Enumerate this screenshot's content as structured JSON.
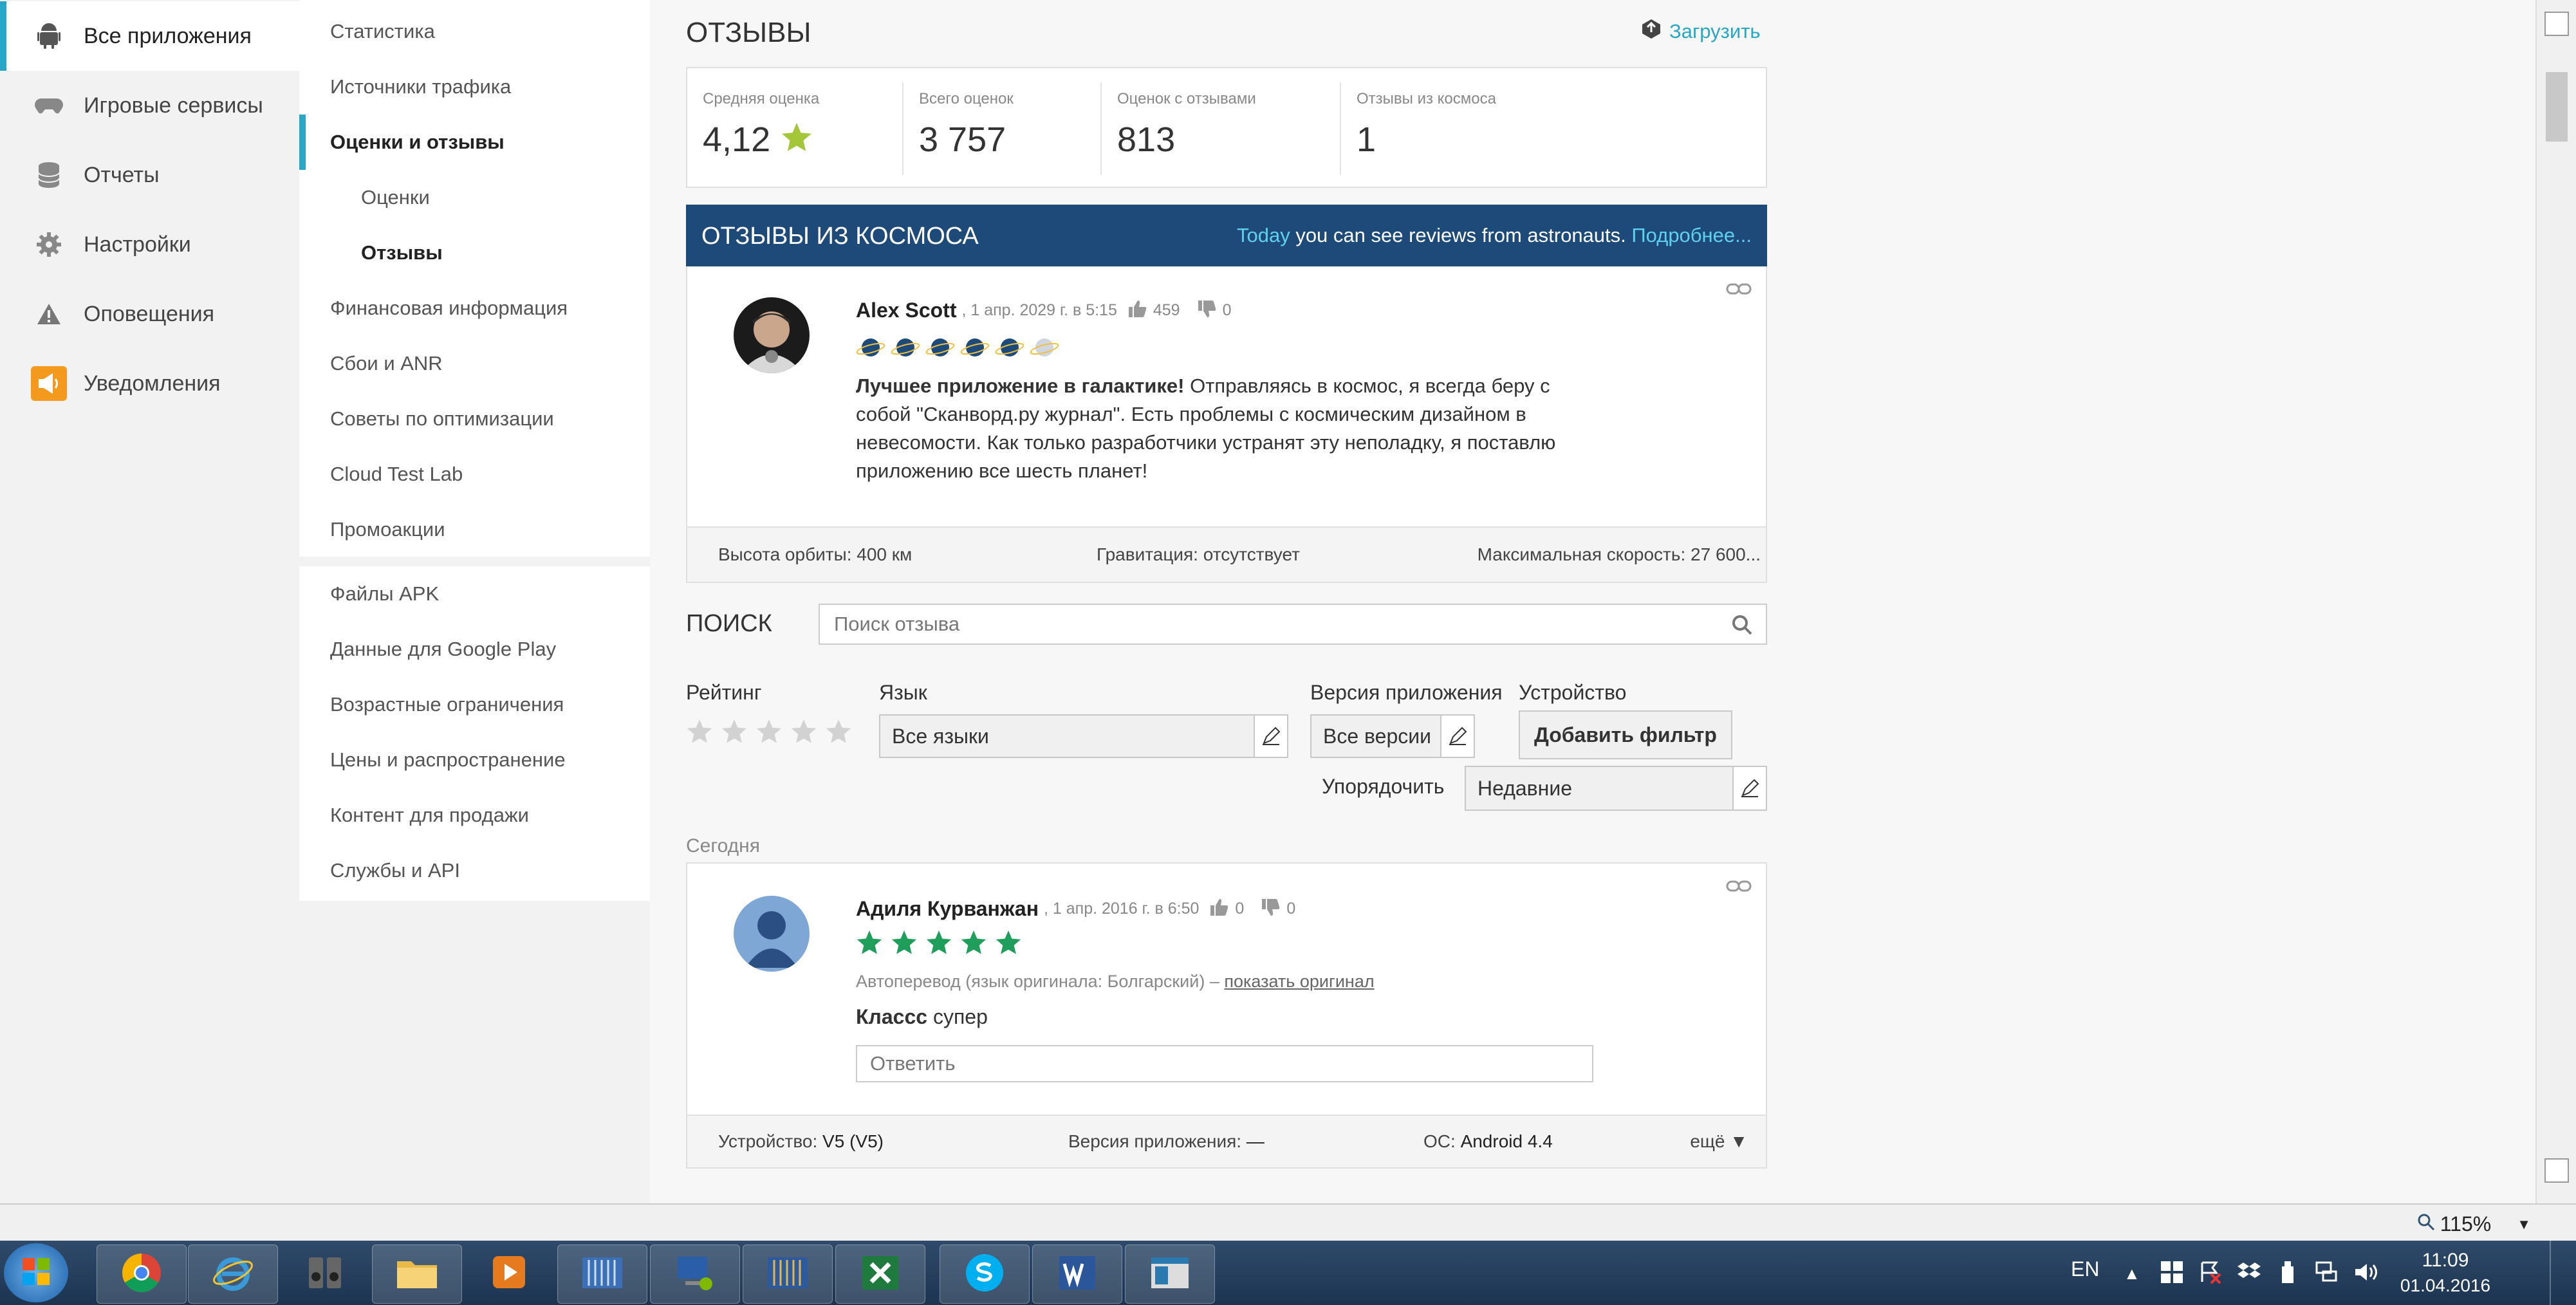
{
  "nav_primary": [
    {
      "label": "Все приложения",
      "icon": "android-icon",
      "active": true
    },
    {
      "label": "Игровые сервисы",
      "icon": "gamepad-icon"
    },
    {
      "label": "Отчеты",
      "icon": "database-icon"
    },
    {
      "label": "Настройки",
      "icon": "gear-icon"
    },
    {
      "label": "Оповещения",
      "icon": "warning-icon"
    },
    {
      "label": "Уведомления",
      "icon": "megaphone-icon"
    }
  ],
  "nav_secondary": {
    "group1": [
      {
        "label": "Статистика"
      },
      {
        "label": "Источники трафика"
      },
      {
        "label": "Оценки и отзывы",
        "bold": true,
        "active": true
      },
      {
        "label": "Оценки",
        "sub": true
      },
      {
        "label": "Отзывы",
        "sub": true,
        "bold": true
      },
      {
        "label": "Финансовая информация"
      },
      {
        "label": "Сбои и ANR"
      },
      {
        "label": "Советы по оптимизации"
      },
      {
        "label": "Cloud Test Lab"
      },
      {
        "label": "Промоакции"
      }
    ],
    "group2": [
      {
        "label": "Файлы APK"
      },
      {
        "label": "Данные для Google Play"
      },
      {
        "label": "Возрастные ограничения"
      },
      {
        "label": "Цены и распространение"
      },
      {
        "label": "Контент для продажи"
      },
      {
        "label": "Службы и API"
      }
    ]
  },
  "header": {
    "title": "ОТЗЫВЫ",
    "upload_label": "Загрузить"
  },
  "stats": [
    {
      "label": "Средняя оценка",
      "value": "4,12"
    },
    {
      "label": "Всего оценок",
      "value": "3 757"
    },
    {
      "label": "Оценок с отзывами",
      "value": "813"
    },
    {
      "label": "Отзывы из космоса",
      "value": "1"
    }
  ],
  "cosmos": {
    "title": "ОТЗЫВЫ ИЗ КОСМОСА",
    "today": "Today",
    "message": " you can see reviews from astronauts. ",
    "more": "Подробнее...",
    "review": {
      "author": "Alex Scott",
      "date": ", 1 апр. 2029 г. в 5:15",
      "likes": "459",
      "dislikes": "0",
      "planets_total": 6,
      "planets_filled": 5,
      "text_bold": "Лучшее приложение в галактике!",
      "text": " Отправляясь в космос, я всегда беру с собой \"Сканворд.ру журнал\". Есть проблемы с космическим дизайном в невесомости. Как только разработчики устранят эту неполадку, я поставлю приложению все шесть планет!"
    },
    "footer": {
      "orbit": "Высота орбиты: 400 км",
      "gravity": "Гравитация: отсутствует",
      "speed": "Максимальная скорость: 27 600..."
    }
  },
  "search": {
    "label": "ПОИСК",
    "placeholder": "Поиск отзыва"
  },
  "filters": {
    "rating_label": "Рейтинг",
    "language_label": "Язык",
    "language_value": "Все языки",
    "version_label": "Версия приложения",
    "version_value": "Все версии",
    "device_label": "Устройство",
    "add_filter": "Добавить фильтр",
    "sort_label": "Упорядочить",
    "sort_value": "Недавние"
  },
  "section_today": "Сегодня",
  "review": {
    "author": "Адиля Курванжан",
    "date": ", 1 апр. 2016 г. в 6:50",
    "likes": "0",
    "dislikes": "0",
    "stars": 5,
    "translation_note": "Автоперевод (язык оригинала: Болгарский) –",
    "show_original": "показать оригинал",
    "text_bold": "Классс",
    "text": " супер",
    "reply_placeholder": "Ответить",
    "footer": {
      "device_label": "Устройство: ",
      "device_value": "V5 (V5)",
      "version_label": "Версия приложения: ",
      "version_value": "—",
      "os_label": "ОС: ",
      "os_value": "Android 4.4",
      "more": "ещё"
    }
  },
  "statusbar": {
    "zoom": "115%"
  },
  "taskbar": {
    "lang": "EN",
    "time": "11:09",
    "date": "01.04.2016"
  },
  "colors": {
    "accent": "#2aa6c6",
    "cosmos_bar": "#1e4a7a",
    "star_green": "#1e9e5a",
    "planet": "#1e4a7a"
  }
}
